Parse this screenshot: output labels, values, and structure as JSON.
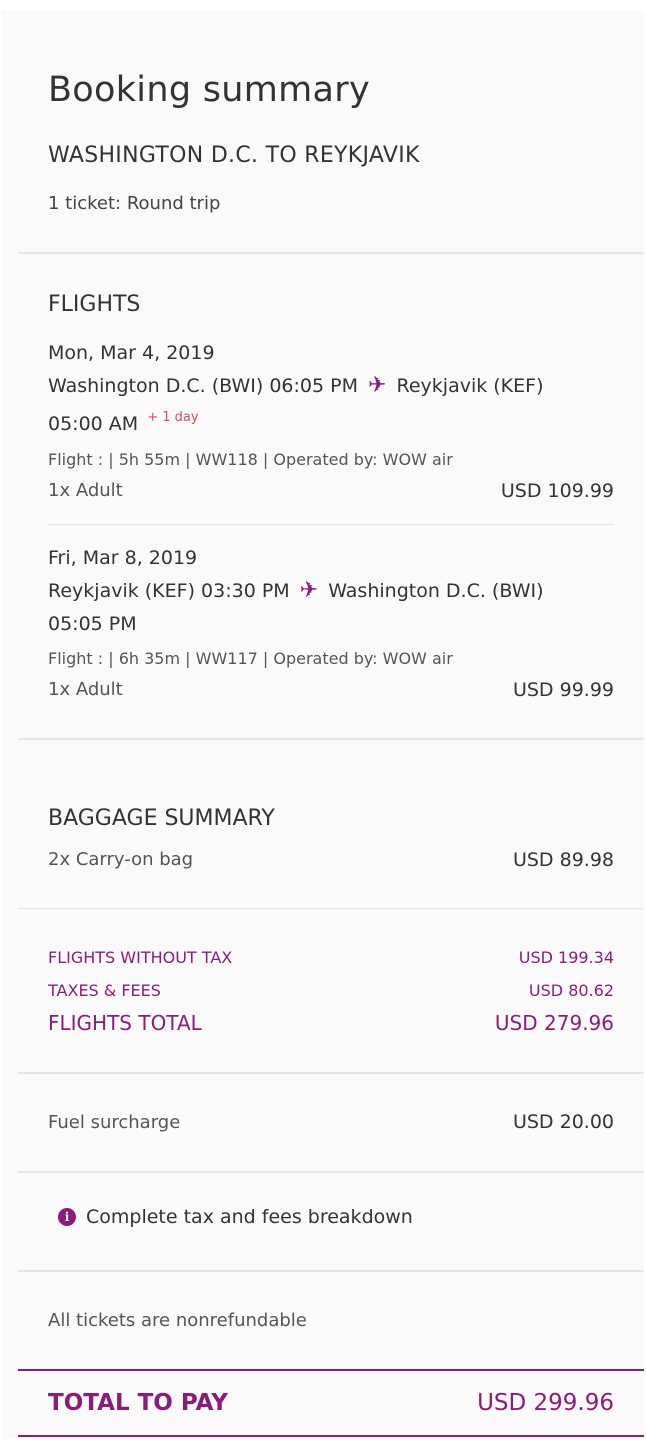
{
  "summary": {
    "title": "Booking summary",
    "route": "WASHINGTON D.C. TO REYKJAVIK",
    "ticket_info": "1 ticket: Round trip"
  },
  "flights": {
    "heading": "FLIGHTS",
    "legs": [
      {
        "date": "Mon, Mar 4, 2019",
        "origin": "Washington D.C. (BWI) 06:05 PM",
        "destination": "Reykjavik (KEF)",
        "arrival": "05:00 AM",
        "day_offset": "+ 1 day",
        "details": "Flight : | 5h 55m | WW118 | Operated by: WOW air",
        "passenger": "1x Adult",
        "price": "USD 109.99"
      },
      {
        "date": "Fri, Mar 8, 2019",
        "origin": "Reykjavik (KEF) 03:30 PM",
        "destination": "Washington D.C. (BWI)",
        "arrival": "05:05 PM",
        "day_offset": "",
        "details": "Flight : | 6h 35m | WW117 | Operated by: WOW air",
        "passenger": "1x Adult",
        "price": "USD 99.99"
      }
    ]
  },
  "baggage": {
    "heading": "BAGGAGE SUMMARY",
    "item": "2x Carry-on bag",
    "price": "USD 89.98"
  },
  "totals": {
    "without_tax_label": "FLIGHTS WITHOUT TAX",
    "without_tax_value": "USD 199.34",
    "taxes_label": "TAXES & FEES",
    "taxes_value": "USD 80.62",
    "flights_total_label": "FLIGHTS TOTAL",
    "flights_total_value": "USD 279.96"
  },
  "fuel": {
    "label": "Fuel surcharge",
    "value": "USD 20.00"
  },
  "breakdown": {
    "icon_glyph": "i",
    "label": "Complete tax and fees breakdown"
  },
  "notice": "All tickets are nonrefundable",
  "grand_total": {
    "label": "TOTAL TO PAY",
    "value": "USD 299.96"
  },
  "colors": {
    "accent": "#8d1b7c",
    "day_offset": "#e04a5a"
  },
  "icons": {
    "plane": "✈"
  }
}
